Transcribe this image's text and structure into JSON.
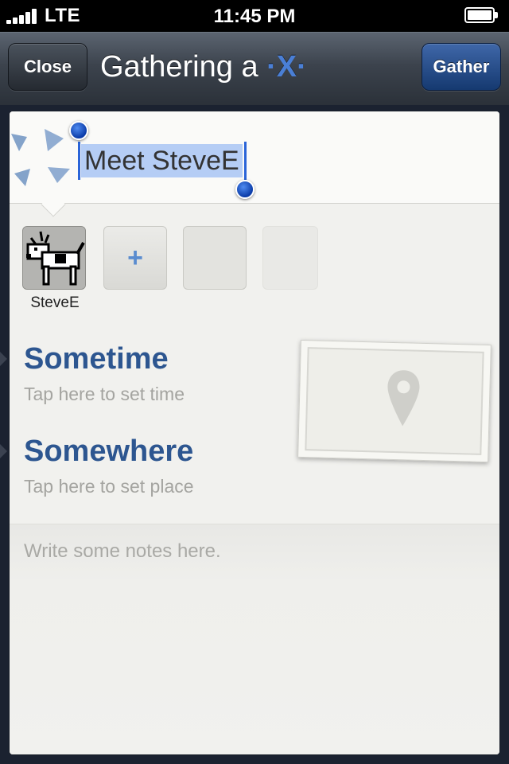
{
  "status_bar": {
    "carrier": "LTE",
    "time": "11:45 PM",
    "signal_bars": 5,
    "battery_level": 1.0
  },
  "navbar": {
    "close_label": "Close",
    "title_text": "Gathering a ",
    "title_logo": "·X·",
    "gather_label": "Gather"
  },
  "event": {
    "title_value": "Meet SteveE"
  },
  "people": {
    "items": [
      {
        "name": "SteveE",
        "avatar": "dog-avatar-icon"
      }
    ],
    "add_glyph": "+"
  },
  "time": {
    "label": "Sometime",
    "hint": "Tap here to set time"
  },
  "place": {
    "label": "Somewhere",
    "hint": "Tap here to set place"
  },
  "notes": {
    "placeholder": "Write some notes here."
  },
  "colors": {
    "accent_blue": "#2d5690",
    "selection": "#b5cdf5",
    "gather_button": "#153970"
  }
}
